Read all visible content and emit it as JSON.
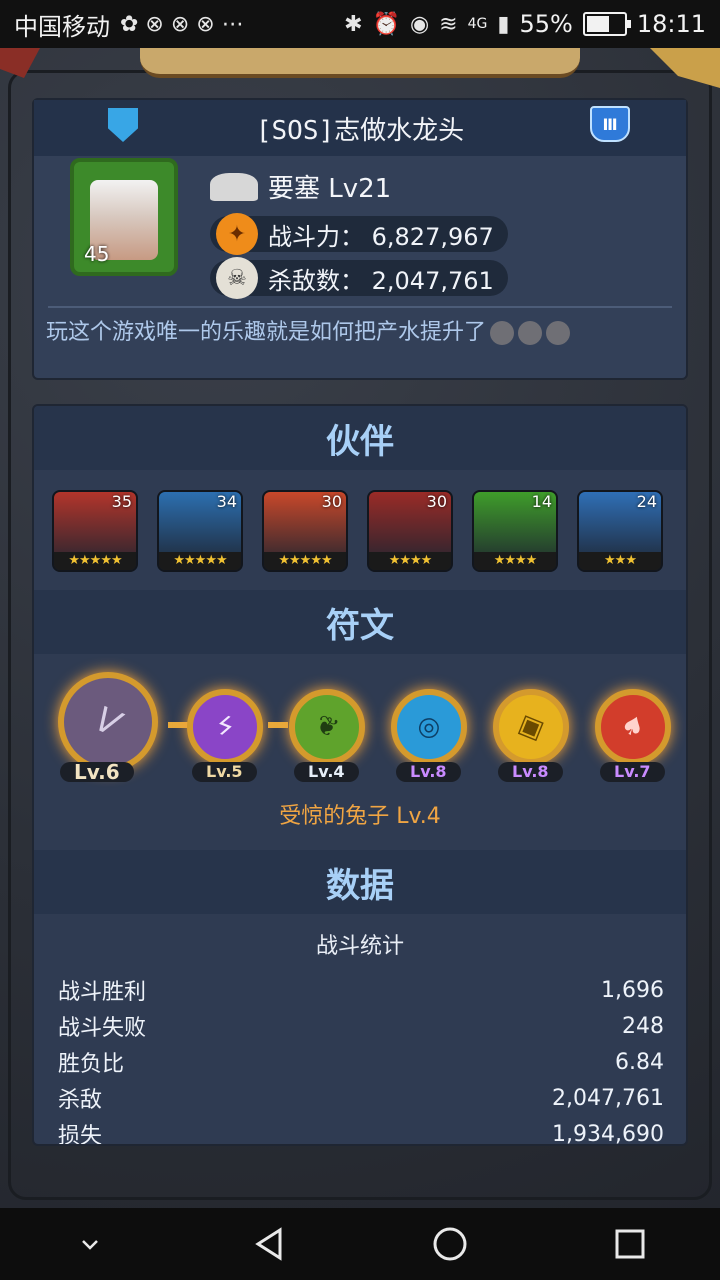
{
  "status_bar": {
    "carrier": "中国移动",
    "network": "4G",
    "battery": "55%",
    "time": "18:11"
  },
  "profile": {
    "name": "[SOS]志做水龙头",
    "avatar_level": "45",
    "rank": "要塞 Lv21",
    "power": "战斗力： 6,827,967",
    "kills": "杀敌数： 2,047,761",
    "motto": "玩这个游戏唯一的乐趣就是如何把产水提升了"
  },
  "partners": {
    "title": "伙伴",
    "heroes": [
      {
        "level": "35",
        "stars": "★★★★★",
        "color": "#b3352b"
      },
      {
        "level": "34",
        "stars": "★★★★★",
        "color": "#2c6fb0"
      },
      {
        "level": "30",
        "stars": "★★★★★",
        "color": "#c9482a"
      },
      {
        "level": "30",
        "stars": "★★★★",
        "color": "#9a2b27"
      },
      {
        "level": "14",
        "stars": "★★★★",
        "color": "#3f9d2a"
      },
      {
        "level": "24",
        "stars": "★★★",
        "color": "#2f6fb6"
      }
    ]
  },
  "runes": {
    "title": "符文",
    "items": [
      {
        "level": "Lv.6",
        "color": "#6b5a7d"
      },
      {
        "level": "Lv.5",
        "color": "#8a45c7"
      },
      {
        "level": "Lv.4",
        "color": "#5fa32c"
      },
      {
        "level": "Lv.8",
        "color": "#2a9ad8"
      },
      {
        "level": "Lv.8",
        "color": "#e7b21e"
      },
      {
        "level": "Lv.7",
        "color": "#d23d2b"
      }
    ],
    "selected_name": "受惊的兔子 Lv.4"
  },
  "data_section": {
    "title": "数据",
    "stats_title": "战斗统计",
    "rows": [
      {
        "label": "战斗胜利",
        "value": "1,696"
      },
      {
        "label": "战斗失败",
        "value": "248"
      },
      {
        "label": "胜负比",
        "value": "6.84"
      },
      {
        "label": "杀敌",
        "value": "2,047,761"
      },
      {
        "label": "损失",
        "value": "1,934,690"
      }
    ]
  },
  "icons": {
    "flag": "banner-flag-icon",
    "shield": "guild-shield-icon",
    "rank": "rank-horn-icon",
    "power": "phoenix-power-icon",
    "kills": "skull-icon"
  }
}
